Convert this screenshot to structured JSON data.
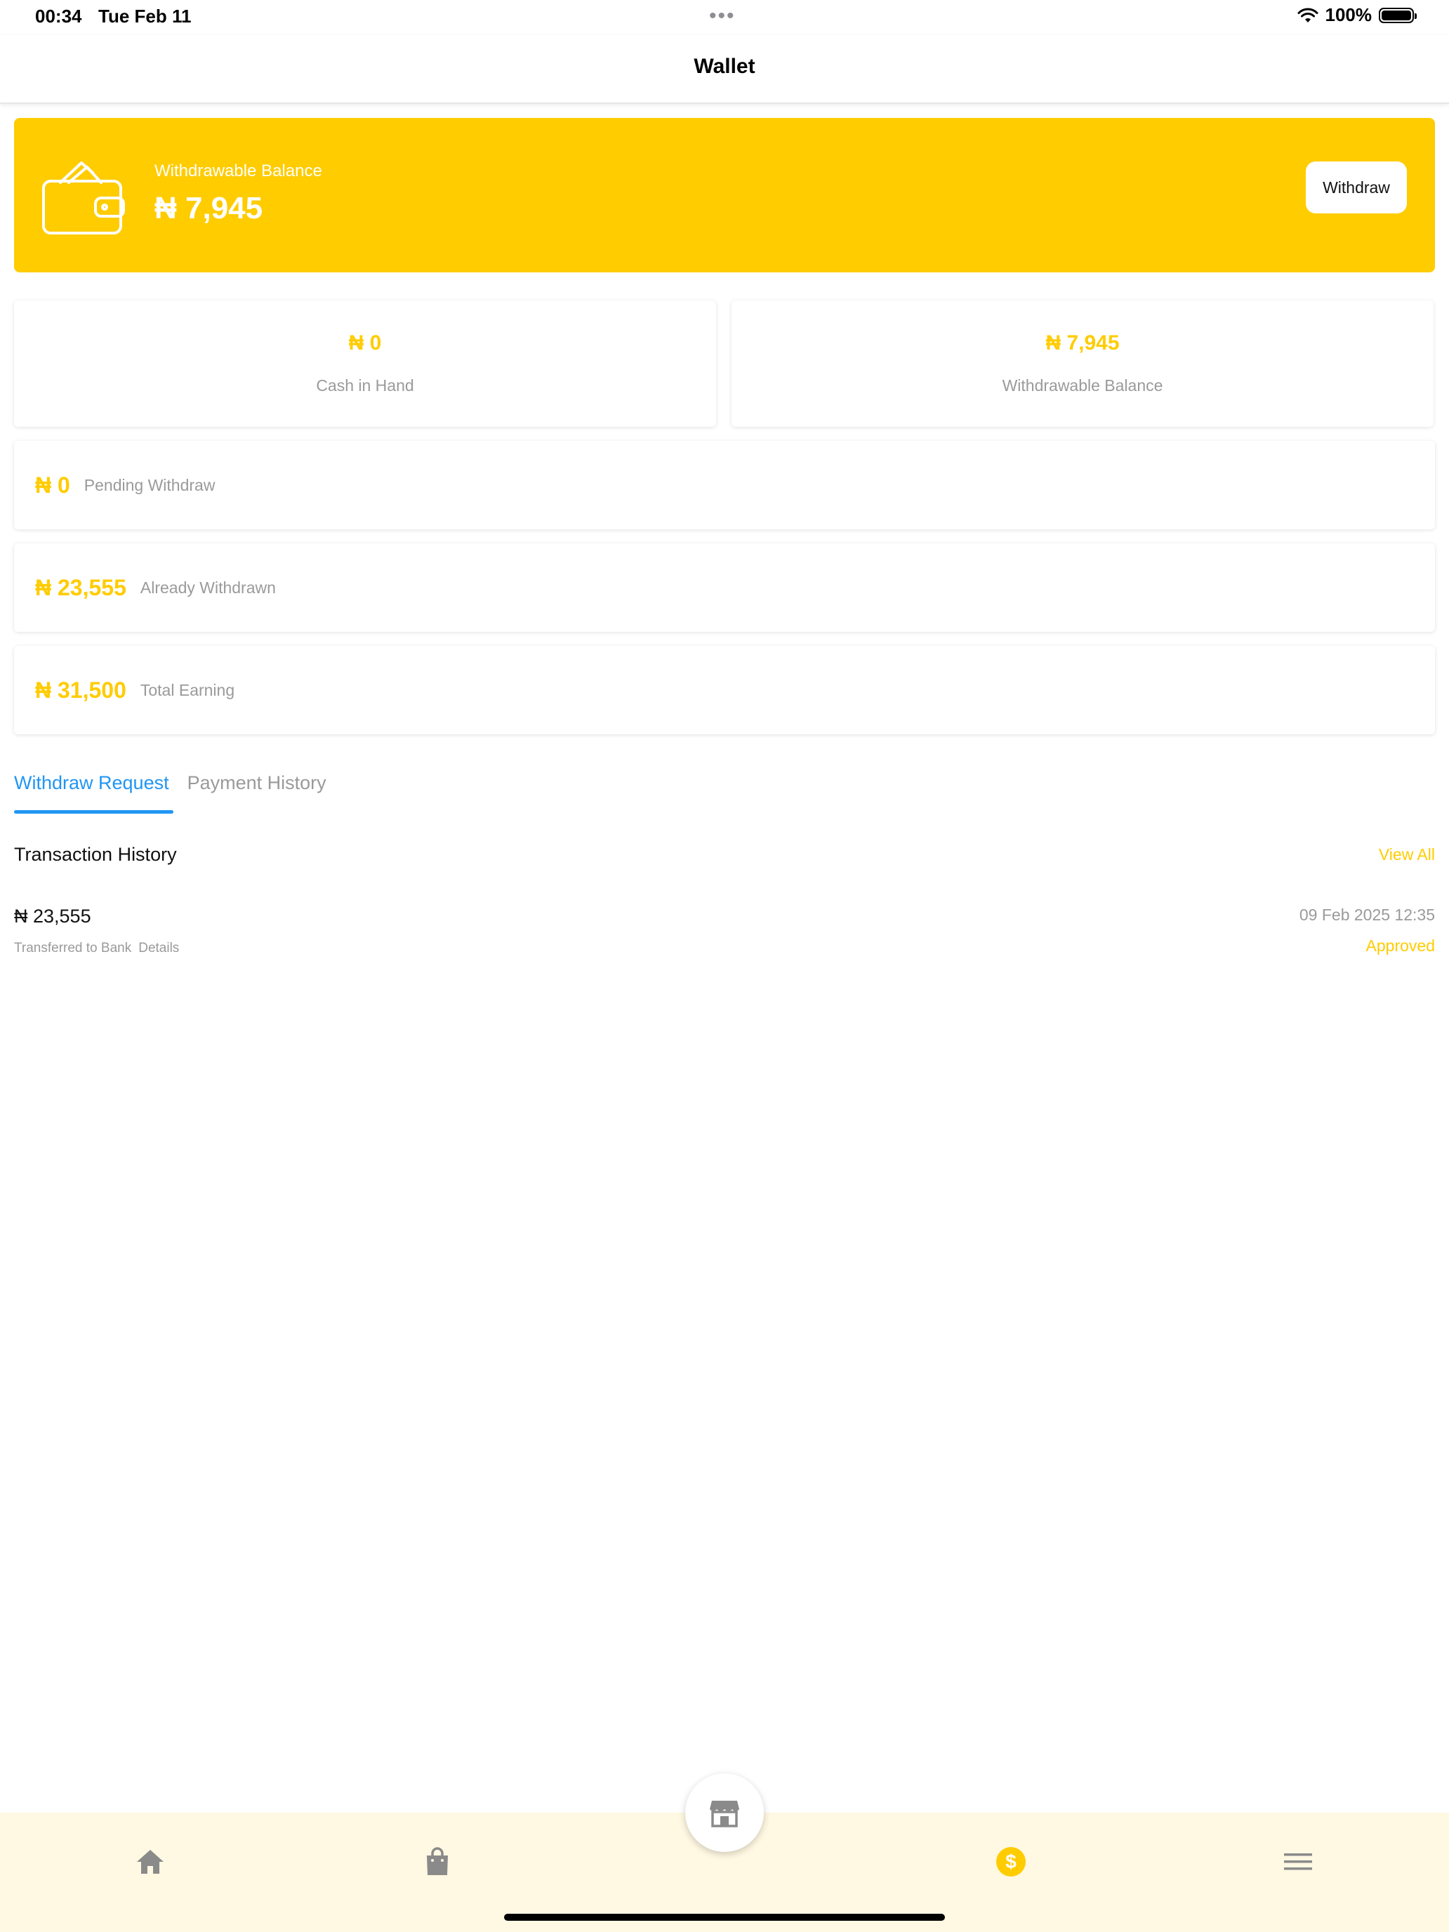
{
  "status_bar": {
    "time": "00:34",
    "date": "Tue Feb 11",
    "battery": "100%"
  },
  "header": {
    "title": "Wallet"
  },
  "balance_card": {
    "label": "Withdrawable Balance",
    "amount": "₦ 7,945",
    "button": "Withdraw"
  },
  "stats": [
    {
      "amount": "₦ 0",
      "label": "Cash in Hand"
    },
    {
      "amount": "₦ 7,945",
      "label": "Withdrawable Balance"
    }
  ],
  "rows": [
    {
      "amount": "₦ 0",
      "label": "Pending Withdraw"
    },
    {
      "amount": "₦ 23,555",
      "label": "Already Withdrawn"
    },
    {
      "amount": "₦ 31,500",
      "label": "Total Earning"
    }
  ],
  "tabs": [
    {
      "label": "Withdraw Request",
      "active": true
    },
    {
      "label": "Payment History",
      "active": false
    }
  ],
  "transactions": {
    "title": "Transaction History",
    "view_all": "View All",
    "items": [
      {
        "amount": "₦ 23,555",
        "description": "Transferred to Bank",
        "details_label": "Details",
        "date": "09 Feb 2025  12:35",
        "status": "Approved"
      }
    ]
  },
  "bottom_nav": {
    "items": [
      "home-icon",
      "shopping-bag-icon",
      "store-icon",
      "dollar-icon",
      "menu-icon"
    ],
    "active": "dollar-icon"
  },
  "colors": {
    "accent": "#ffcc00",
    "tab_active": "#2196f3",
    "muted_text": "#9a9a9a",
    "nav_bg": "#fff8e2"
  }
}
